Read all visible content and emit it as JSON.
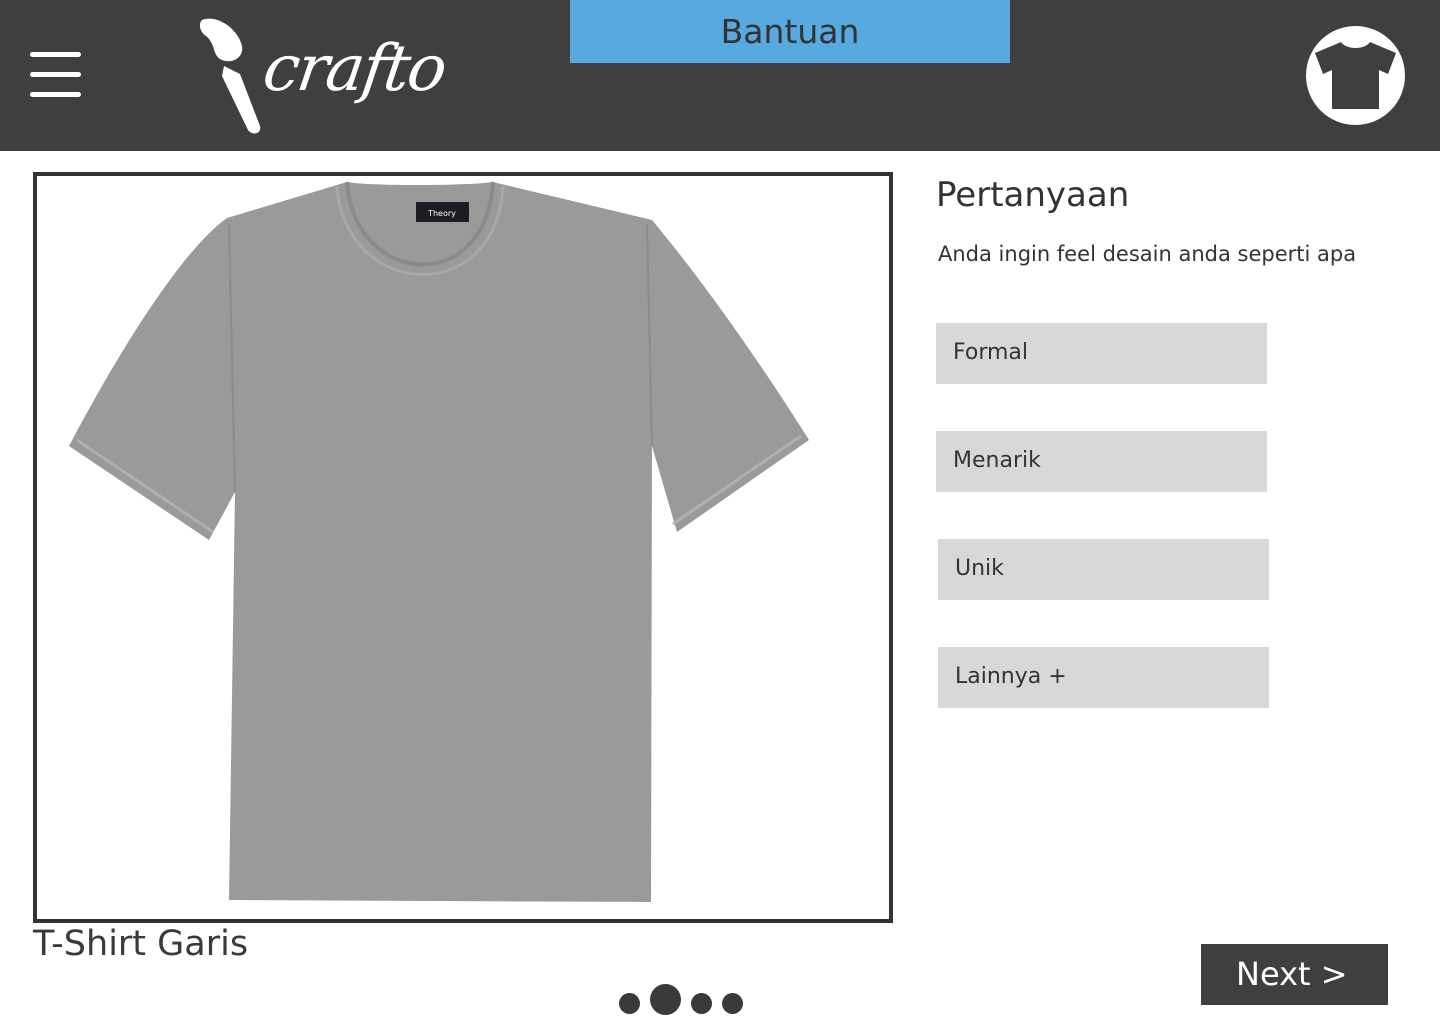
{
  "header": {
    "logo_text": "crafto",
    "help_label": "Bantuan"
  },
  "icons": {
    "menu": "hamburger-icon",
    "logo_mark": "brush-icon",
    "shirt": "tshirt-icon"
  },
  "preview": {
    "product_name": "T-Shirt Garis",
    "label_text": "Theory",
    "shirt_color": "#9a9a9a"
  },
  "pagination": {
    "count": 4,
    "active_index": 1
  },
  "question": {
    "title": "Pertanyaan",
    "prompt": "Anda ingin feel desain anda seperti apa",
    "options": [
      {
        "label": "Formal"
      },
      {
        "label": "Menarik"
      },
      {
        "label": "Unik"
      },
      {
        "label": "Lainnya +"
      }
    ]
  },
  "footer": {
    "next_label": "Next >"
  },
  "colors": {
    "header_bg": "#3f3f3f",
    "help_bg": "#57a9e0",
    "option_bg": "#d8d8d8",
    "next_bg": "#3f3f3f"
  }
}
